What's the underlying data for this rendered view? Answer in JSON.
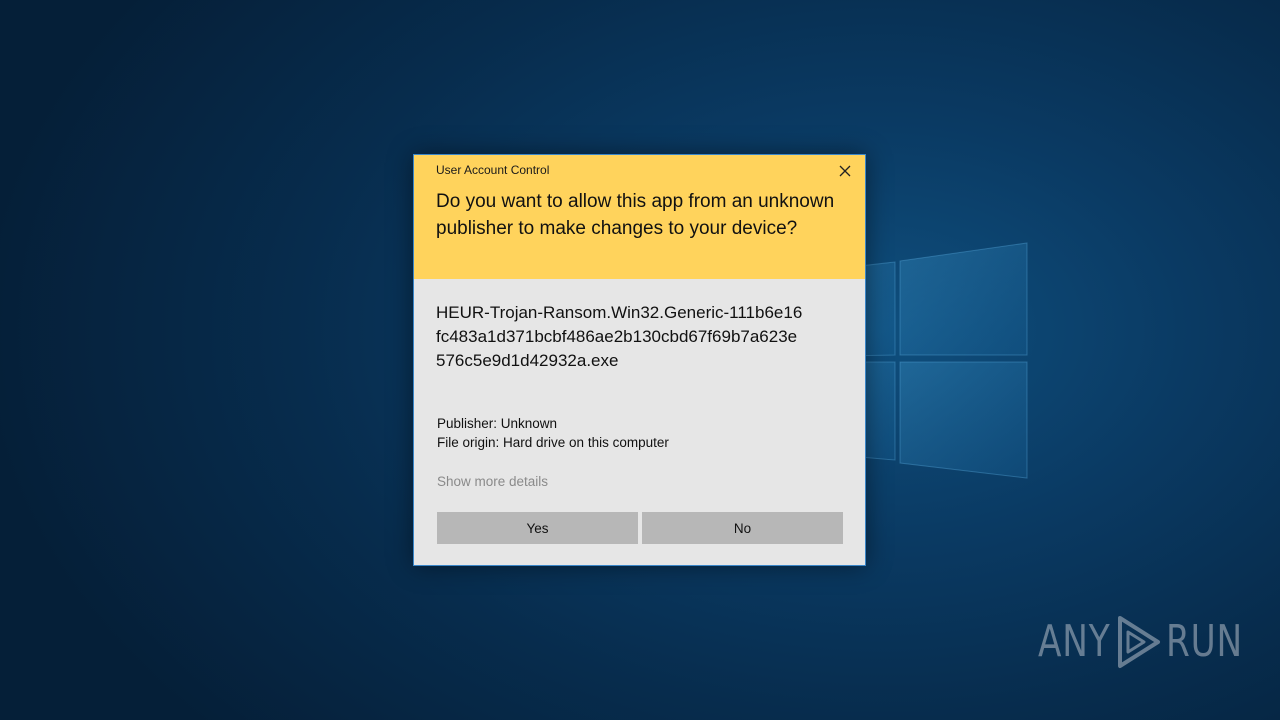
{
  "dialog": {
    "title": "User Account Control",
    "question": "Do you want to allow this app from an unknown publisher to make changes to your device?",
    "app_name": "HEUR-Trojan-Ransom.Win32.Generic-111b6e16fc483a1d371bcbf486ae2b130cbd67f69b7a623e576c5e9d1d42932a.exe",
    "publisher": "Publisher: Unknown",
    "file_origin": "File origin: Hard drive on this computer",
    "show_more": "Show more details",
    "yes_label": "Yes",
    "no_label": "No",
    "close_icon": "close-icon"
  },
  "watermark": {
    "text_left": "ANY",
    "text_right": "RUN",
    "icon": "play-icon"
  },
  "colors": {
    "header_bg": "#ffd35c",
    "body_bg": "#e6e6e6",
    "button_bg": "#b7b7b7",
    "border": "#3a86c8"
  }
}
